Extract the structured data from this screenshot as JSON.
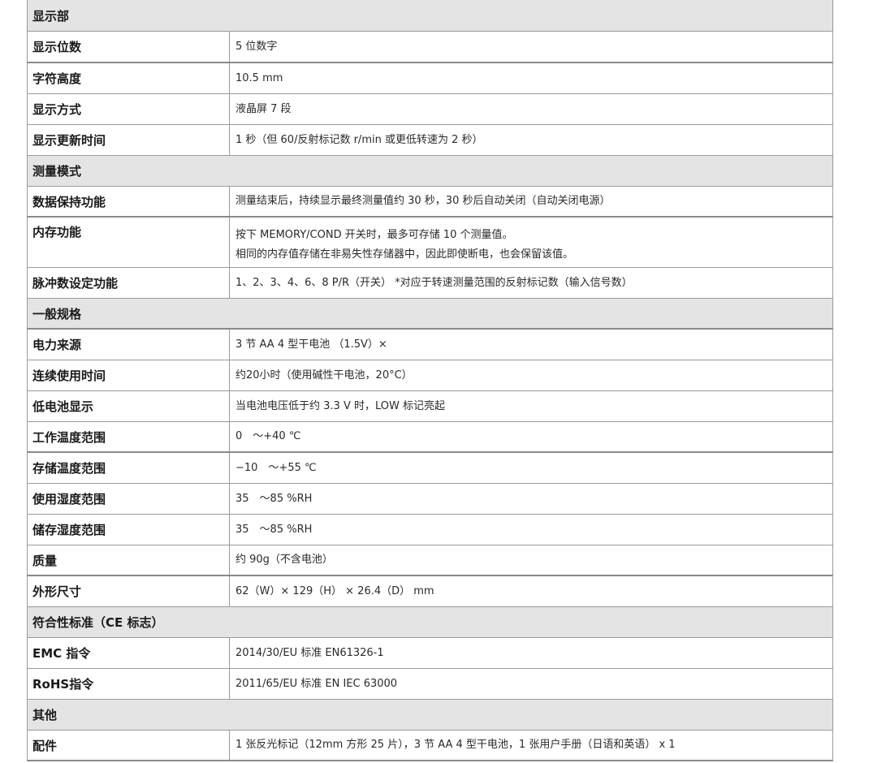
{
  "rows": [
    {
      "type": "section",
      "label": "显示部",
      "h": 39
    },
    {
      "type": "row",
      "label": "显示位数",
      "value": [
        "5 位数字"
      ],
      "h": 39,
      "thick": true
    },
    {
      "type": "row",
      "label": "字符高度",
      "value": [
        "10.5 mm"
      ],
      "h": 38
    },
    {
      "type": "row",
      "label": "显示方式",
      "value": [
        "液晶屏 7 段"
      ],
      "h": 38
    },
    {
      "type": "row",
      "label": "显示更新时间",
      "value": [
        "1 秒（但 60/反射标记数 r/min 或更低转速为 2 秒）"
      ],
      "h": 38
    },
    {
      "type": "section",
      "label": "测量模式",
      "h": 38
    },
    {
      "type": "row",
      "label": "数据保持功能",
      "value": [
        "测量结束后，持续显示最终测量值约 30 秒，30 秒后自动关闭（自动关闭电源）"
      ],
      "h": 38,
      "thick": true
    },
    {
      "type": "row",
      "label": "内存功能",
      "value": [
        "按下 MEMORY/COND 开关时，最多可存储 10 个测量值。",
        "相同的内存值存储在非易失性存储器中，因此即使断电，也会保留该值。"
      ],
      "h": 62,
      "top": true
    },
    {
      "type": "row",
      "label": "脉冲数设定功能",
      "value": [
        "1、2、3、4、6、8 P/R（开关） *对应于转速测量范围的反射标记数（输入信号数）"
      ],
      "h": 38
    },
    {
      "type": "section",
      "label": "一般规格",
      "h": 38,
      "thick": true
    },
    {
      "type": "row",
      "label": "电力来源",
      "value": [
        "3 节 AA 4 型干电池 （1.5V）×"
      ],
      "h": 38
    },
    {
      "type": "row",
      "label": "连续使用时间",
      "value": [
        "约20小时（使用碱性干电池，20°C）"
      ],
      "h": 38
    },
    {
      "type": "row",
      "label": "低电池显示",
      "value": [
        "当电池电压低于约 3.3 V 时，LOW 标记亮起"
      ],
      "h": 38
    },
    {
      "type": "row",
      "label": "工作温度范围",
      "value": [
        "0　～+40 ℃"
      ],
      "h": 38,
      "thick": true
    },
    {
      "type": "row",
      "label": "存储温度范围",
      "value": [
        "−10　～+55 ℃"
      ],
      "h": 38
    },
    {
      "type": "row",
      "label": "使用湿度范围",
      "value": [
        "35　～85 %RH"
      ],
      "h": 38
    },
    {
      "type": "row",
      "label": "储存湿度范围",
      "value": [
        "35　～85 %RH"
      ],
      "h": 38
    },
    {
      "type": "row",
      "label": "质量",
      "value": [
        "约 90g（不含电池）"
      ],
      "h": 38,
      "thick": true
    },
    {
      "type": "row",
      "label": "外形尺寸",
      "value": [
        "62（W）× 129（H） × 26.4（D） mm"
      ],
      "h": 38
    },
    {
      "type": "section",
      "label": "符合性标准（CE 标志）",
      "h": 38
    },
    {
      "type": "row",
      "label": "EMC 指令",
      "value": [
        "2014/30/EU 标准 EN61326-1"
      ],
      "h": 38
    },
    {
      "type": "row",
      "label": "RoHS指令",
      "value": [
        "2011/65/EU 标准 EN IEC 63000"
      ],
      "h": 38
    },
    {
      "type": "section",
      "label": "其他",
      "h": 38
    },
    {
      "type": "row",
      "label": "配件",
      "value": [
        "1 张反光标记（12mm 方形 25 片），3 节 AA 4 型干电池，1 张用户手册（日语和英语） x 1"
      ],
      "h": 38,
      "thick": true
    }
  ]
}
